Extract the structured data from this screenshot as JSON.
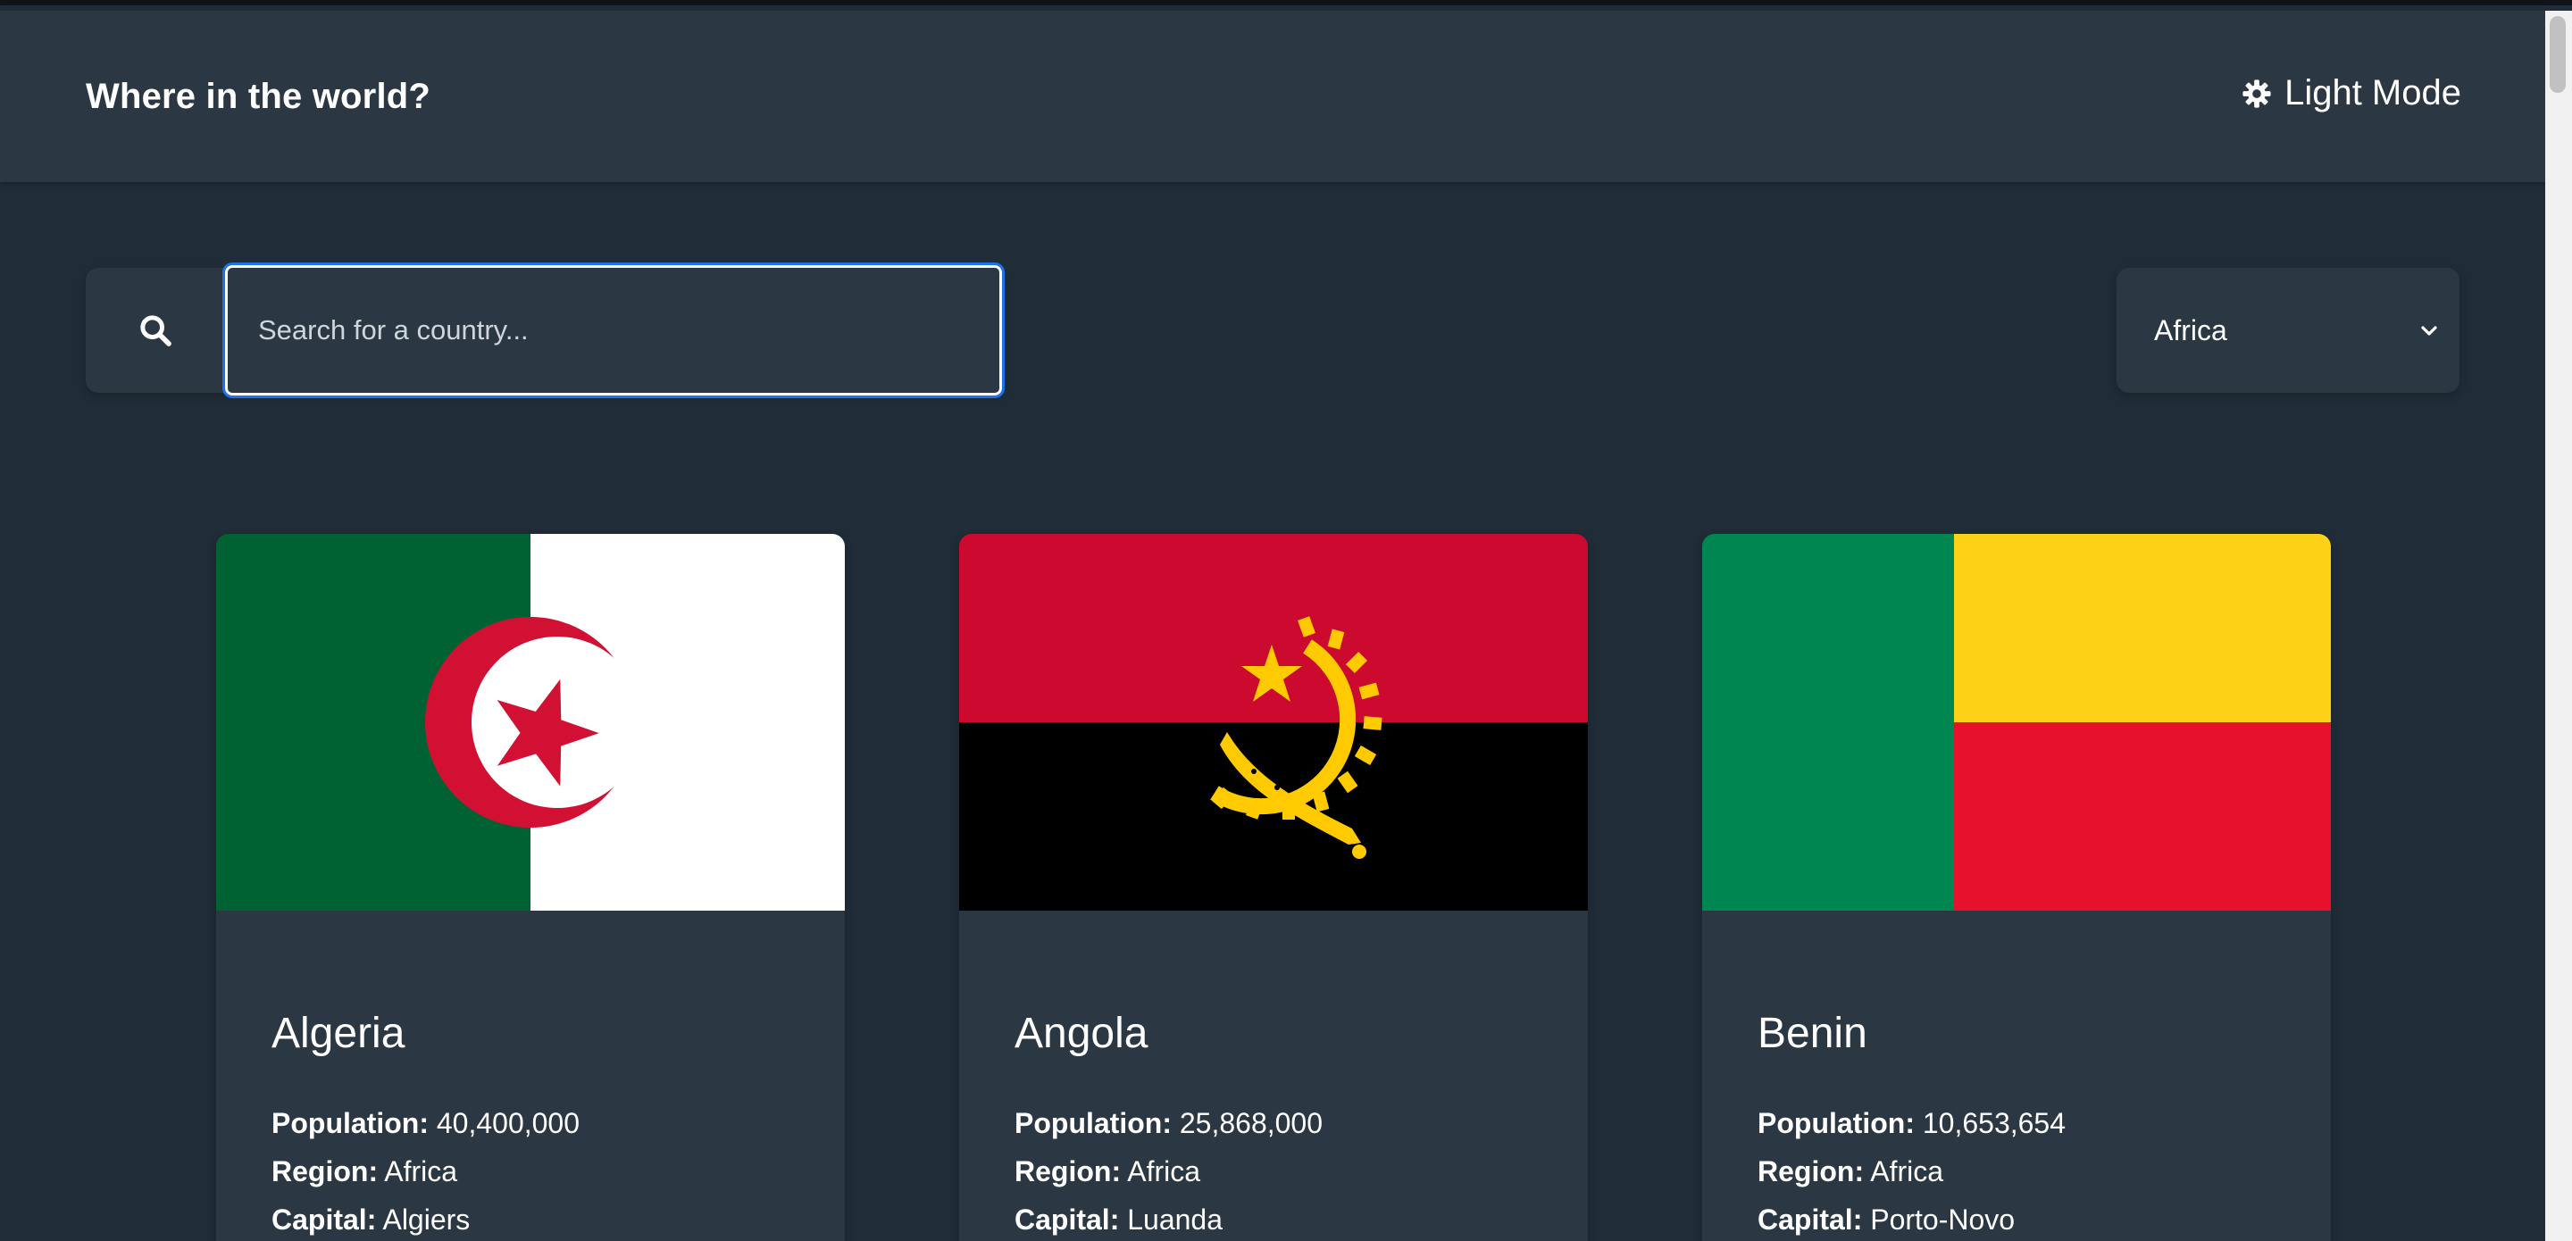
{
  "header": {
    "title": "Where in the world?",
    "theme_label": "Light Mode",
    "theme_icon": "sun-gear-icon"
  },
  "search": {
    "placeholder": "Search for a country...",
    "value": "",
    "icon": "search-icon"
  },
  "filter": {
    "selected": "Africa",
    "icon": "chevron-down-icon"
  },
  "labels": {
    "population": "Population:",
    "region": "Region:",
    "capital": "Capital:"
  },
  "countries": [
    {
      "name": "Algeria",
      "population": "40,400,000",
      "region": "Africa",
      "capital": "Algiers"
    },
    {
      "name": "Angola",
      "population": "25,868,000",
      "region": "Africa",
      "capital": "Luanda"
    },
    {
      "name": "Benin",
      "population": "10,653,654",
      "region": "Africa",
      "capital": "Porto-Novo"
    }
  ],
  "colors": {
    "background": "#202c37",
    "element": "#2b3743",
    "text": "#ffffff",
    "focus_ring": "#1a73e8"
  }
}
